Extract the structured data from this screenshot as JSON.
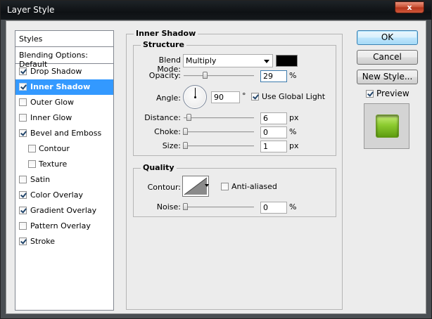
{
  "window": {
    "title": "Layer Style",
    "close_label": "x"
  },
  "styles_panel": {
    "header": "Styles",
    "blending_default": "Blending Options: Default",
    "items": [
      {
        "label": "Drop Shadow",
        "checked": true,
        "selected": false,
        "sub": false
      },
      {
        "label": "Inner Shadow",
        "checked": true,
        "selected": true,
        "sub": false
      },
      {
        "label": "Outer Glow",
        "checked": false,
        "selected": false,
        "sub": false
      },
      {
        "label": "Inner Glow",
        "checked": false,
        "selected": false,
        "sub": false
      },
      {
        "label": "Bevel and Emboss",
        "checked": true,
        "selected": false,
        "sub": false
      },
      {
        "label": "Contour",
        "checked": false,
        "selected": false,
        "sub": true
      },
      {
        "label": "Texture",
        "checked": false,
        "selected": false,
        "sub": true
      },
      {
        "label": "Satin",
        "checked": false,
        "selected": false,
        "sub": false
      },
      {
        "label": "Color Overlay",
        "checked": true,
        "selected": false,
        "sub": false
      },
      {
        "label": "Gradient Overlay",
        "checked": true,
        "selected": false,
        "sub": false
      },
      {
        "label": "Pattern Overlay",
        "checked": false,
        "selected": false,
        "sub": false
      },
      {
        "label": "Stroke",
        "checked": true,
        "selected": false,
        "sub": false
      }
    ]
  },
  "inner_shadow": {
    "title": "Inner Shadow",
    "structure": {
      "title": "Structure",
      "blend_mode_label": "Blend Mode:",
      "blend_mode_value": "Multiply",
      "shadow_color": "#000000",
      "opacity_label": "Opacity:",
      "opacity_value": "29",
      "opacity_unit": "%",
      "angle_label": "Angle:",
      "angle_value": "90",
      "angle_unit": "°",
      "use_global_light_label": "Use Global Light",
      "use_global_light": true,
      "distance_label": "Distance:",
      "distance_value": "6",
      "distance_unit": "px",
      "choke_label": "Choke:",
      "choke_value": "0",
      "choke_unit": "%",
      "size_label": "Size:",
      "size_value": "1",
      "size_unit": "px"
    },
    "quality": {
      "title": "Quality",
      "contour_label": "Contour:",
      "anti_aliased_label": "Anti-aliased",
      "anti_aliased": false,
      "noise_label": "Noise:",
      "noise_value": "0",
      "noise_unit": "%"
    }
  },
  "buttons": {
    "ok": "OK",
    "cancel": "Cancel",
    "new_style": "New Style..."
  },
  "preview": {
    "label": "Preview",
    "checked": true
  }
}
